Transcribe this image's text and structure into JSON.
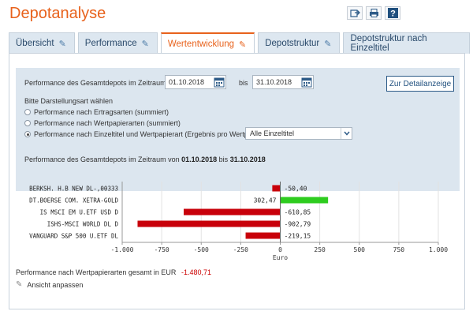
{
  "header": {
    "title": "Depotanalyse"
  },
  "top_icons": [
    "export-icon",
    "print-icon",
    "help-icon"
  ],
  "tabs": [
    {
      "label": "Übersicht",
      "active": false
    },
    {
      "label": "Performance",
      "active": false
    },
    {
      "label": "Wertentwicklung",
      "active": true
    },
    {
      "label": "Depotstruktur",
      "active": false
    },
    {
      "label": "Depotstruktur nach Einzeltitel",
      "active": false
    }
  ],
  "filter": {
    "period_label": "Performance des Gesamtdepots im Zeitraum von",
    "date_from": "01.10.2018",
    "bis_label": "bis",
    "date_to": "31.10.2018",
    "detail_button": "Zur Detailanzeige",
    "display_label": "Bitte Darstellungsart wählen",
    "options": [
      {
        "label": "Performance nach Ertragsarten (summiert)",
        "checked": false
      },
      {
        "label": "Performance nach Wertpapierarten (summiert)",
        "checked": false
      },
      {
        "label": "Performance nach Einzeltitel und Wertpapierart (Ergebnis pro Wertpapier)",
        "checked": true
      }
    ],
    "select_value": "Alle Einzeltitel",
    "summary_prefix": "Performance des Gesamtdepots im Zeitraum von",
    "summary_from": "01.10.2018",
    "summary_bis": "bis",
    "summary_to": "31.10.2018"
  },
  "chart_data": {
    "type": "bar",
    "orientation": "horizontal",
    "categories": [
      "BERKSH. H.B NEW DL-,00333",
      "DT.BOERSE COM. XETRA-GOLD",
      "IS MSCI EM U.ETF USD D",
      "ISHS-MSCI WORLD DL D",
      "VANGUARD S&P 500 U.ETF DL"
    ],
    "values": [
      -50.4,
      302.47,
      -610.85,
      -902.79,
      -219.15
    ],
    "value_labels": [
      "-50,40",
      "302,47",
      "-610,85",
      "-902,79",
      "-219,15"
    ],
    "xlabel": "Euro",
    "xlim": [
      -1000,
      1000
    ],
    "xticks": [
      -1000,
      -750,
      -500,
      -250,
      0,
      250,
      500,
      750,
      1000
    ],
    "xtick_labels": [
      "-1.000",
      "-750",
      "-500",
      "-250",
      "0",
      "250",
      "500",
      "750",
      "1.000"
    ],
    "grid": true,
    "colors": {
      "negative": "#c8000a",
      "positive": "#2ecc1f"
    }
  },
  "footer": {
    "total_label": "Performance nach Wertpapierarten gesamt in EUR",
    "total_value": "-1.480,71",
    "adjust_label": "Ansicht anpassen"
  }
}
